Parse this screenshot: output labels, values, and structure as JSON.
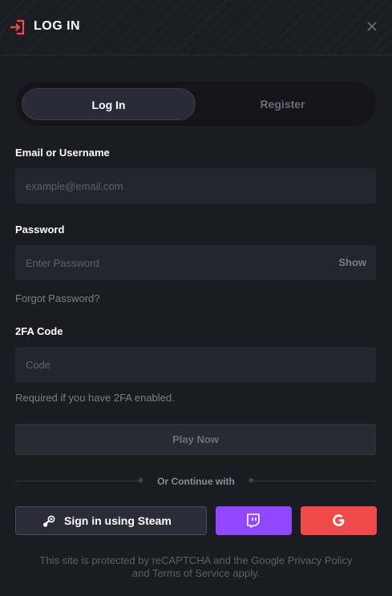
{
  "modal": {
    "title": "LOG IN",
    "login_icon": "login-icon",
    "close_icon": "close-icon"
  },
  "tabs": [
    {
      "label": "Log In",
      "active": true
    },
    {
      "label": "Register",
      "active": false
    }
  ],
  "form": {
    "email_label": "Email or Username",
    "email_placeholder": "example@email.com",
    "email_value": "",
    "password_label": "Password",
    "password_placeholder": "Enter Password",
    "password_value": "",
    "show_label": "Show",
    "forgot_link": "Forgot Password?",
    "twofa_label": "2FA Code",
    "twofa_placeholder": "Code",
    "twofa_value": "",
    "twofa_hint": "Required if you have 2FA enabled.",
    "submit_label": "Play Now"
  },
  "social": {
    "divider_text": "Or Continue with",
    "steam_label": "Sign in using Steam",
    "steam_icon": "steam-icon",
    "twitch_icon": "twitch-icon",
    "google_icon": "google-icon"
  },
  "footer": {
    "prefix": "This site is protected by reCAPTCHA and the Google ",
    "privacy_link": "Privacy Policy",
    "middle": "and ",
    "terms_link": "Terms of Service",
    "suffix": " apply."
  },
  "colors": {
    "background": "#1b1b22",
    "accent_red": "#f14a4a",
    "twitch_purple": "#9146ff",
    "input_bg": "#25252f"
  }
}
